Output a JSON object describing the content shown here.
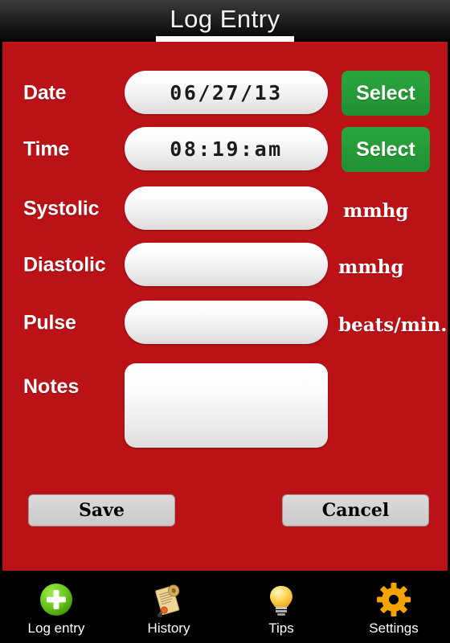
{
  "header": {
    "title": "Log Entry"
  },
  "form": {
    "fields": [
      {
        "label": "Date",
        "value": "06/27/13",
        "placeholder": "",
        "unit": "",
        "action": "Select"
      },
      {
        "label": "Time",
        "value": "08:19:am",
        "placeholder": "",
        "unit": "",
        "action": "Select"
      },
      {
        "label": "Systolic",
        "value": "",
        "placeholder": "",
        "unit": "mmhg",
        "action": ""
      },
      {
        "label": "Diastolic",
        "value": "",
        "placeholder": "",
        "unit": "mmhg",
        "action": ""
      },
      {
        "label": "Pulse",
        "value": "",
        "placeholder": "",
        "unit": "beats/min.",
        "action": ""
      }
    ],
    "notes": {
      "label": "Notes",
      "value": "",
      "placeholder": ""
    },
    "save_label": "Save",
    "cancel_label": "Cancel"
  },
  "navbar": {
    "items": [
      {
        "label": "Log entry",
        "icon": "plus-circle-icon"
      },
      {
        "label": "History",
        "icon": "scroll-icon"
      },
      {
        "label": "Tips",
        "icon": "lightbulb-icon"
      },
      {
        "label": "Settings",
        "icon": "gear-icon"
      }
    ]
  },
  "colors": {
    "panel_red": "#bb1217",
    "select_green": "#26a03a",
    "nav_black": "#000000",
    "button_gray": "#d2d2d2",
    "accent_orange": "#f5a300",
    "plus_green": "#63c419"
  }
}
